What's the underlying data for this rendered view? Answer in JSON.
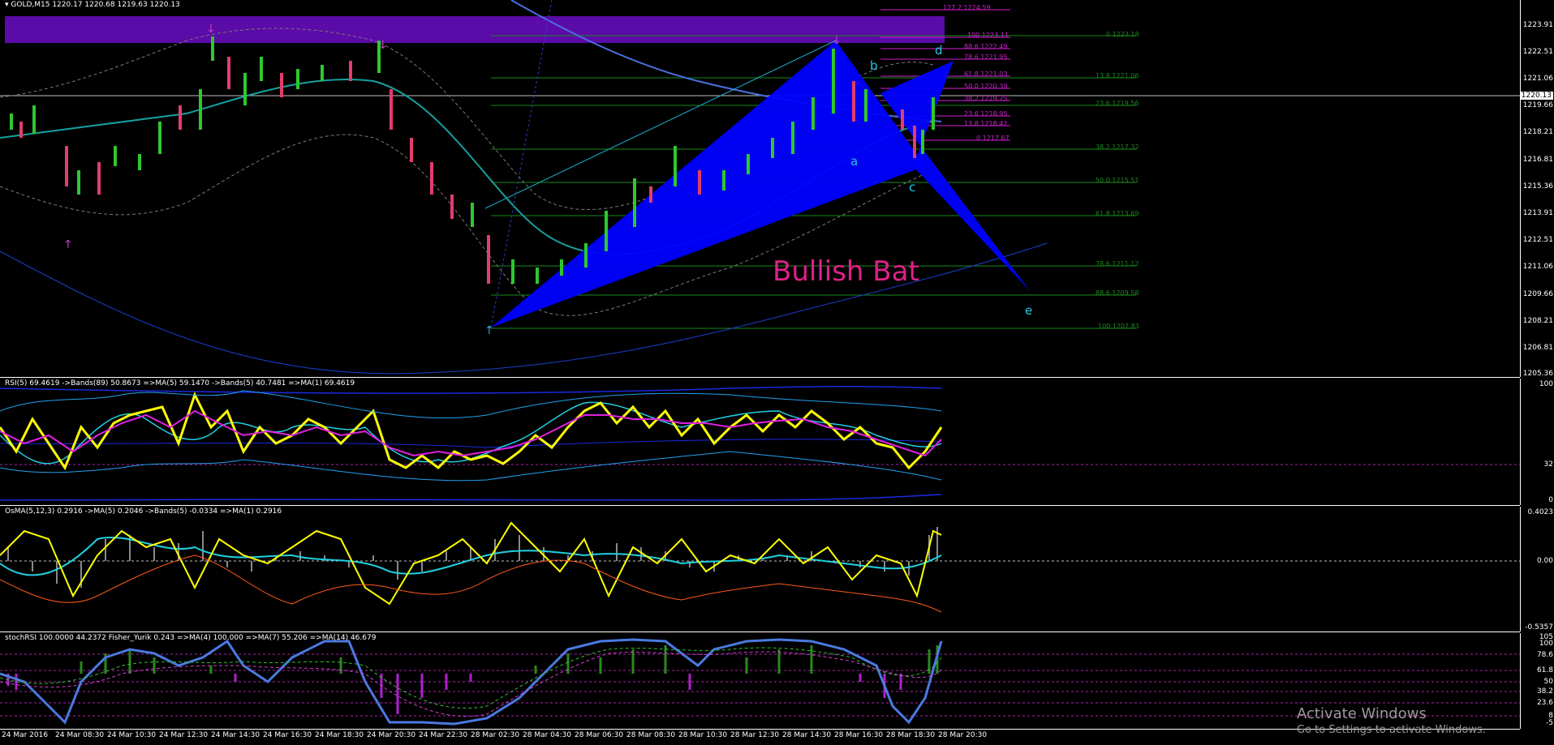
{
  "main_chart": {
    "symbol_header": "GOLD,M15  1220.17 1220.68 1219.63 1220.13",
    "current_price": "1220.13",
    "pattern_label": "Bullish Bat",
    "pattern_label_color": "#e0208a",
    "harmonic_fill_color": "#0000ff",
    "supply_zone_color": "#5b0ba8",
    "point_labels": [
      "a",
      "b",
      "c",
      "d",
      "e"
    ],
    "price_ticks": [
      "1223.91",
      "1222.51",
      "1221.06",
      "1219.66",
      "1218.21",
      "1216.81",
      "1215.36",
      "1213.91",
      "1212.51",
      "1211.06",
      "1209.66",
      "1208.21",
      "1206.81",
      "1205.36"
    ],
    "fib_right_labels": [
      "127.2 1224.59",
      "100 1223.11",
      "88.6 1222.49",
      "78.6 1221.95",
      "61.8 1221.03",
      "50.0 1220.39",
      "38.2 1219.75",
      "23.6 1218.95",
      "13.8 1218.42",
      "0 1217.67"
    ],
    "fib_far_labels": [
      "0 1223.18",
      "13.8 1221.06",
      "23.6 1219.56",
      "38.2 1217.32",
      "50.0 1215.51",
      "61.8 1213.69",
      "78.6 1211.12",
      "88.6 1209.58",
      "100 1207.83"
    ]
  },
  "rsi_pane": {
    "header": "RSI(5) 69.4619  ->Bands(89) 50.8673  =>MA(5) 59.1470  ->Bands(5) 40.7481  =>MA(1) 69.4619",
    "ticks": [
      "100",
      "32",
      "0"
    ]
  },
  "osma_pane": {
    "header": "OsMA(5,12,3) 0.2916  ->MA(5) 0.2046  ->Bands(5) -0.0334  =>MA(1) 0.2916",
    "ticks": [
      "0.4023",
      "0.00",
      "-0.5357"
    ]
  },
  "stoch_pane": {
    "header": "stochRSI 100.0000 44.2372  Fisher_Yurik 0.243  =>MA(4) 100.000  =>MA(7) 55.206  =>MA(14) 46.679",
    "ticks": [
      "105",
      "100",
      "78.6",
      "61.8",
      "50",
      "38.2",
      "23.6",
      "8",
      "-5"
    ]
  },
  "time_axis": [
    "24 Mar 2016",
    "24 Mar 08:30",
    "24 Mar 10:30",
    "24 Mar 12:30",
    "24 Mar 14:30",
    "24 Mar 16:30",
    "24 Mar 18:30",
    "24 Mar 20:30",
    "24 Mar 22:30",
    "28 Mar 02:30",
    "28 Mar 04:30",
    "28 Mar 06:30",
    "28 Mar 08:30",
    "28 Mar 10:30",
    "28 Mar 12:30",
    "28 Mar 14:30",
    "28 Mar 16:30",
    "28 Mar 18:30",
    "28 Mar 20:30"
  ],
  "watermark": {
    "line1": "Activate Windows",
    "line2": "Go to Settings to activate Windows."
  }
}
